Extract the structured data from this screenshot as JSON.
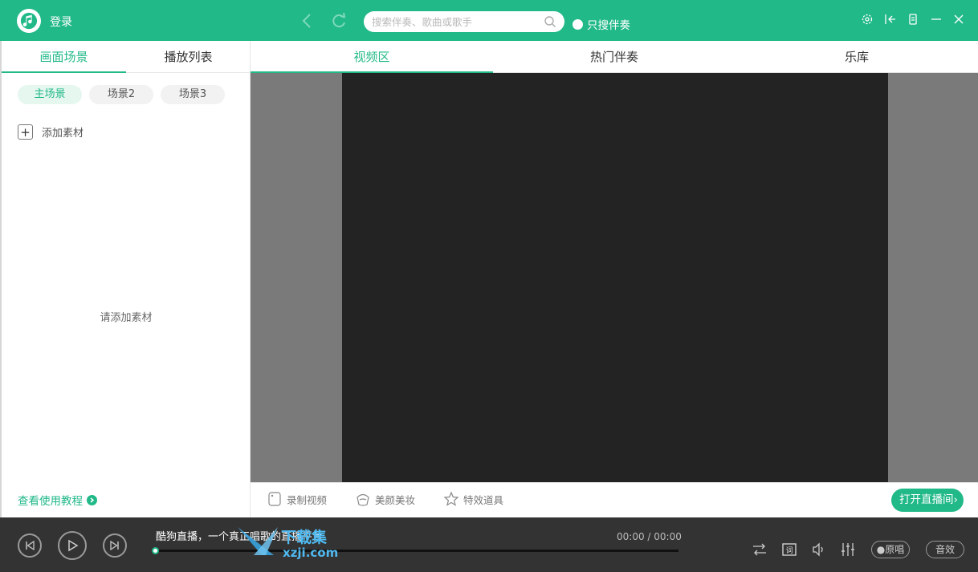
{
  "header": {
    "login_label": "登录",
    "search_placeholder": "搜索伴奏、歌曲或歌手",
    "only_accompaniment_label": "只搜伴奏"
  },
  "left_panel": {
    "tabs": [
      "画面场景",
      "播放列表"
    ],
    "active_tab": 0,
    "scenes": [
      "主场景",
      "场景2",
      "场景3"
    ],
    "active_scene": 0,
    "add_material_label": "添加素材",
    "empty_hint": "请添加素材",
    "tutorial_label": "查看使用教程"
  },
  "main_tabs": {
    "tabs": [
      "视频区",
      "热门伴奏",
      "乐库"
    ],
    "active_tab": 0
  },
  "toolbar": {
    "record_label": "录制视频",
    "beauty_label": "美颜美妆",
    "effects_label": "特效道具",
    "go_live_label": "打开直播间"
  },
  "player": {
    "song_title": "酷狗直播，一个真正唱歌的直播平台",
    "time": "00:00 / 00:00",
    "progress": 0,
    "original_label": "原唱",
    "sound_label": "音效"
  },
  "watermark": {
    "text": "下载集",
    "sub": "xzji.com"
  },
  "colors": {
    "accent": "#22b988",
    "player_bg": "#333333",
    "video_bg": "#7a7a7a",
    "video_screen": "#232323"
  }
}
